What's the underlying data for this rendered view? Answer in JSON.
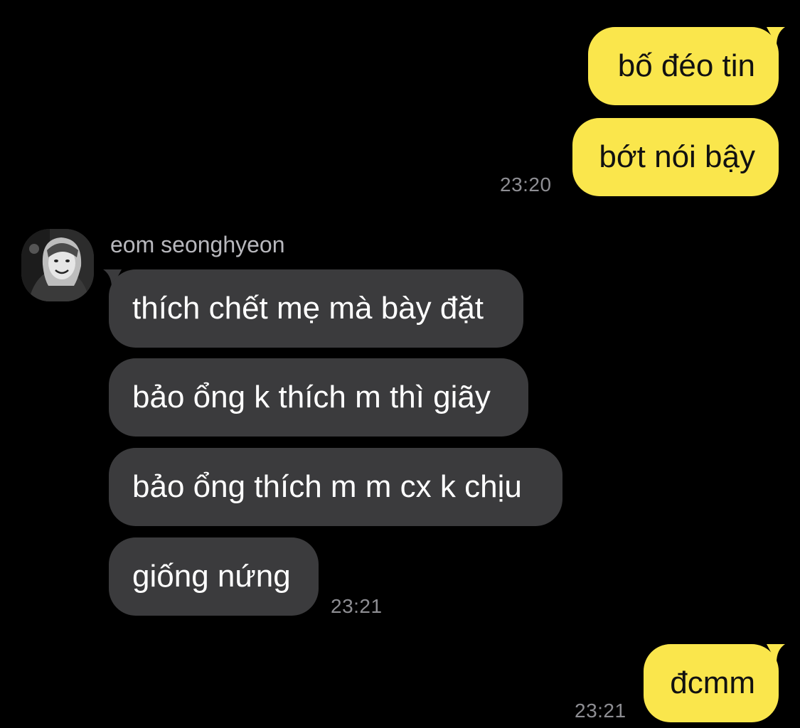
{
  "chat": {
    "outgoing_group_1": {
      "messages": [
        "bố đéo tin",
        "bớt nói bậy"
      ],
      "time": "23:20"
    },
    "incoming_group": {
      "sender_name": "eom seonghyeon",
      "messages": [
        "thích chết mẹ mà bày đặt",
        "bảo ổng k thích m thì giãy",
        "bảo ổng thích m m cx k chịu",
        "giống nứng"
      ],
      "time": "23:21"
    },
    "outgoing_group_2": {
      "messages": [
        "đcmm"
      ],
      "time": "23:21"
    }
  },
  "colors": {
    "background": "#000000",
    "outgoing_bubble": "#fae64c",
    "incoming_bubble": "#3b3b3d",
    "timestamp": "#8e8e93"
  },
  "icons": {
    "avatar": "user-avatar-photo"
  }
}
